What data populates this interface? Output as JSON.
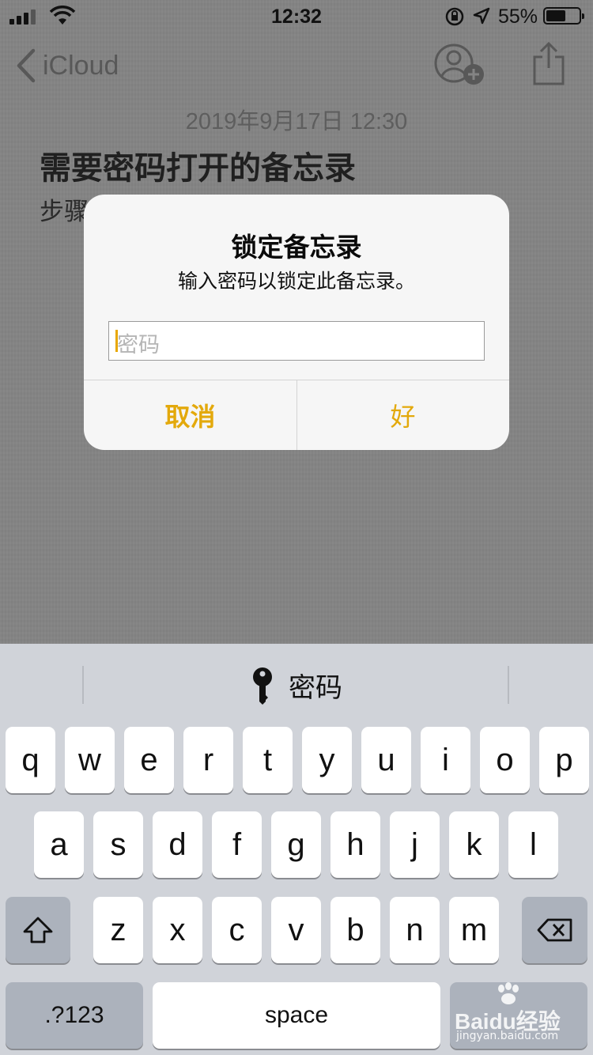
{
  "status_bar": {
    "time": "12:32",
    "battery_percent": "55%",
    "battery_level": 0.55,
    "signal_bars": 4,
    "signal_bars_active": 3
  },
  "nav": {
    "back_label": "iCloud",
    "back_icon": "chevron-left-icon",
    "add_person_icon": "add-person-icon",
    "share_icon": "share-icon"
  },
  "note": {
    "date": "2019年9月17日 12:30",
    "title": "需要密码打开的备忘录",
    "body": "步骤"
  },
  "alert": {
    "title": "锁定备忘录",
    "message": "输入密码以锁定此备忘录。",
    "input_placeholder": "密码",
    "cancel_label": "取消",
    "ok_label": "好",
    "accent_color": "#e3a90c"
  },
  "keyboard": {
    "suggestion_label": "密码",
    "suggestion_icon": "key-icon",
    "row1": [
      "q",
      "w",
      "e",
      "r",
      "t",
      "y",
      "u",
      "i",
      "o",
      "p"
    ],
    "row2": [
      "a",
      "s",
      "d",
      "f",
      "g",
      "h",
      "j",
      "k",
      "l"
    ],
    "row3": [
      "z",
      "x",
      "c",
      "v",
      "b",
      "n",
      "m"
    ],
    "numbers_label": ".?123",
    "space_label": "space",
    "shift_icon": "shift-icon",
    "delete_icon": "delete-icon"
  },
  "watermark": {
    "text": "Baidu经验",
    "url_text": "jingyan.baidu.com"
  }
}
